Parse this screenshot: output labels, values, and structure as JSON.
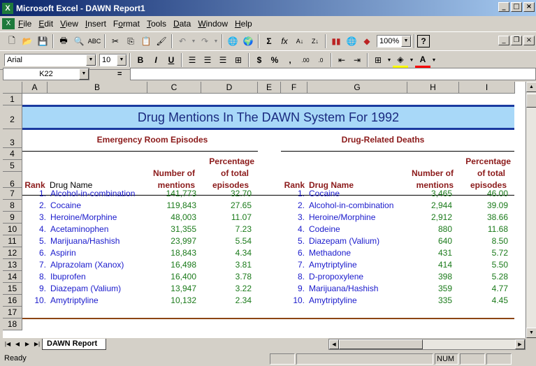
{
  "window": {
    "title": "Microsoft Excel - DAWN Report1",
    "app_icon": "X"
  },
  "menu": [
    "File",
    "Edit",
    "View",
    "Insert",
    "Format",
    "Tools",
    "Data",
    "Window",
    "Help"
  ],
  "menu_mnemonic": [
    "F",
    "E",
    "V",
    "I",
    "o",
    "T",
    "D",
    "W",
    "H"
  ],
  "toolbar": {
    "zoom": "100%",
    "font": "Arial",
    "size": "10"
  },
  "formula": {
    "namebox": "K22",
    "equals": "="
  },
  "columns": [
    "A",
    "B",
    "C",
    "D",
    "E",
    "F",
    "G",
    "H",
    "I"
  ],
  "rows": [
    "1",
    "2",
    "3",
    "4",
    "5",
    "6",
    "7",
    "8",
    "9",
    "10",
    "11",
    "12",
    "13",
    "14",
    "15",
    "16",
    "17",
    "18"
  ],
  "sheet": {
    "title": "Drug Mentions In The DAWN System For 1992",
    "left_section": "Emergency Room Episodes",
    "right_section": "Drug-Related Deaths",
    "hdr_rank": "Rank",
    "hdr_drug": "Drug Name",
    "hdr_num1": "Number of",
    "hdr_num2": "mentions",
    "hdr_pct1": "Percentage",
    "hdr_pct2": "of total",
    "hdr_pct3": "episodes",
    "er": [
      {
        "rank": "1.",
        "drug": "Alcohol-in-combination",
        "num": "141,773",
        "pct": "32.70"
      },
      {
        "rank": "2.",
        "drug": "Cocaine",
        "num": "119,843",
        "pct": "27.65"
      },
      {
        "rank": "3.",
        "drug": "Heroine/Morphine",
        "num": "48,003",
        "pct": "11.07"
      },
      {
        "rank": "4.",
        "drug": "Acetaminophen",
        "num": "31,355",
        "pct": "7.23"
      },
      {
        "rank": "5.",
        "drug": "Marijuana/Hashish",
        "num": "23,997",
        "pct": "5.54"
      },
      {
        "rank": "6.",
        "drug": "Aspirin",
        "num": "18,843",
        "pct": "4.34"
      },
      {
        "rank": "7.",
        "drug": "Alprazolam (Xanox)",
        "num": "16,498",
        "pct": "3.81"
      },
      {
        "rank": "8.",
        "drug": "Ibuprofen",
        "num": "16,400",
        "pct": "3.78"
      },
      {
        "rank": "9.",
        "drug": "Diazepam (Valium)",
        "num": "13,947",
        "pct": "3.22"
      },
      {
        "rank": "10.",
        "drug": "Amytriptyline",
        "num": "10,132",
        "pct": "2.34"
      }
    ],
    "deaths": [
      {
        "rank": "1.",
        "drug": "Cocaine",
        "num": "3,465",
        "pct": "46.00"
      },
      {
        "rank": "2.",
        "drug": "Alcohol-in-combination",
        "num": "2,944",
        "pct": "39.09"
      },
      {
        "rank": "3.",
        "drug": "Heroine/Morphine",
        "num": "2,912",
        "pct": "38.66"
      },
      {
        "rank": "4.",
        "drug": "Codeine",
        "num": "880",
        "pct": "11.68"
      },
      {
        "rank": "5.",
        "drug": "Diazepam (Valium)",
        "num": "640",
        "pct": "8.50"
      },
      {
        "rank": "6.",
        "drug": "Methadone",
        "num": "431",
        "pct": "5.72"
      },
      {
        "rank": "7.",
        "drug": "Amytriptyline",
        "num": "414",
        "pct": "5.50"
      },
      {
        "rank": "8.",
        "drug": "D-propoxylene",
        "num": "398",
        "pct": "5.28"
      },
      {
        "rank": "9.",
        "drug": "Marijuana/Hashish",
        "num": "359",
        "pct": "4.77"
      },
      {
        "rank": "10.",
        "drug": "Amytriptyline",
        "num": "335",
        "pct": "4.45"
      }
    ]
  },
  "tab": "DAWN Report",
  "status": {
    "ready": "Ready",
    "num": "NUM"
  }
}
